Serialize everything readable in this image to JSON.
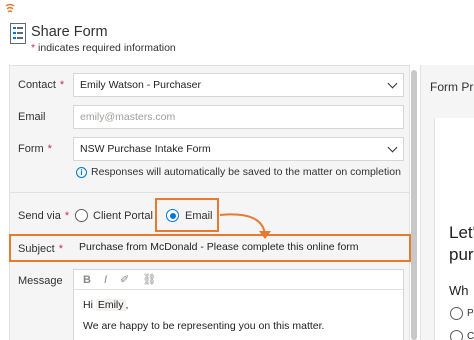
{
  "header": {
    "title": "Share Form",
    "required_note": "indicates required information",
    "required_star": "*"
  },
  "form": {
    "contact_label": "Contact",
    "contact_value": "Emily Watson - Purchaser",
    "email_label": "Email",
    "email_placeholder": "emily@masters.com",
    "form_label": "Form",
    "form_value": "NSW Purchase Intake Form",
    "info_text": "Responses will automatically be saved to the matter on completion",
    "send_via_label": "Send via",
    "send_options": [
      "Client Portal",
      "Email"
    ],
    "send_selected": "Email",
    "subject_label": "Subject",
    "subject_value": "Purchase from McDonald - Please complete this online form",
    "message_label": "Message",
    "toolbar": [
      "B",
      "I",
      "✐",
      "⛓"
    ],
    "message_greeting": "Hi",
    "message_name": "Emily",
    "message_greeting_end": ",",
    "message_line2": "We are happy to be representing you on this matter."
  },
  "preview": {
    "title": "Form Pr",
    "heading_line1": "Let'",
    "heading_line2": "pur",
    "question": "Wh",
    "option1": "P",
    "option2": "C"
  },
  "colors": {
    "highlight": "#e8792e",
    "accent": "#0078d4",
    "required": "#c4314b"
  }
}
